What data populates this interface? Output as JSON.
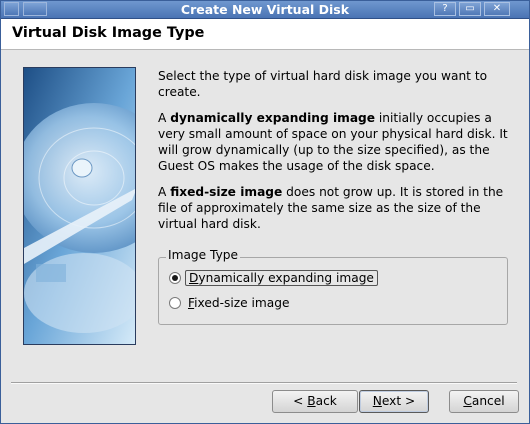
{
  "window": {
    "title": "Create New Virtual Disk",
    "help": "?",
    "minimize": "▭",
    "close": "✕"
  },
  "header": {
    "title": "Virtual Disk Image Type"
  },
  "body": {
    "intro": "Select the type of virtual hard disk image you want to create.",
    "dynamic_prefix": "A ",
    "dynamic_bold": "dynamically expanding image",
    "dynamic_rest": " initially occupies a very small amount of space on your physical hard disk. It will grow dynamically (up to the size specified), as the Guest OS makes the usage of the disk space.",
    "fixed_prefix": "A ",
    "fixed_bold": "fixed-size image",
    "fixed_rest": " does not grow up. It is stored in the file of approximately the same size as the size of the virtual hard disk."
  },
  "image_type": {
    "legend": "Image Type",
    "options": [
      {
        "mnemonic": "D",
        "rest": "ynamically expanding image",
        "selected": true
      },
      {
        "mnemonic": "F",
        "rest": "ixed-size image",
        "selected": false
      }
    ]
  },
  "buttons": {
    "back": {
      "prefix": "< ",
      "mnemonic": "B",
      "rest": "ack"
    },
    "next": {
      "mnemonic": "N",
      "rest": "ext",
      "suffix": " >"
    },
    "cancel": {
      "mnemonic": "C",
      "rest": "ancel"
    }
  }
}
